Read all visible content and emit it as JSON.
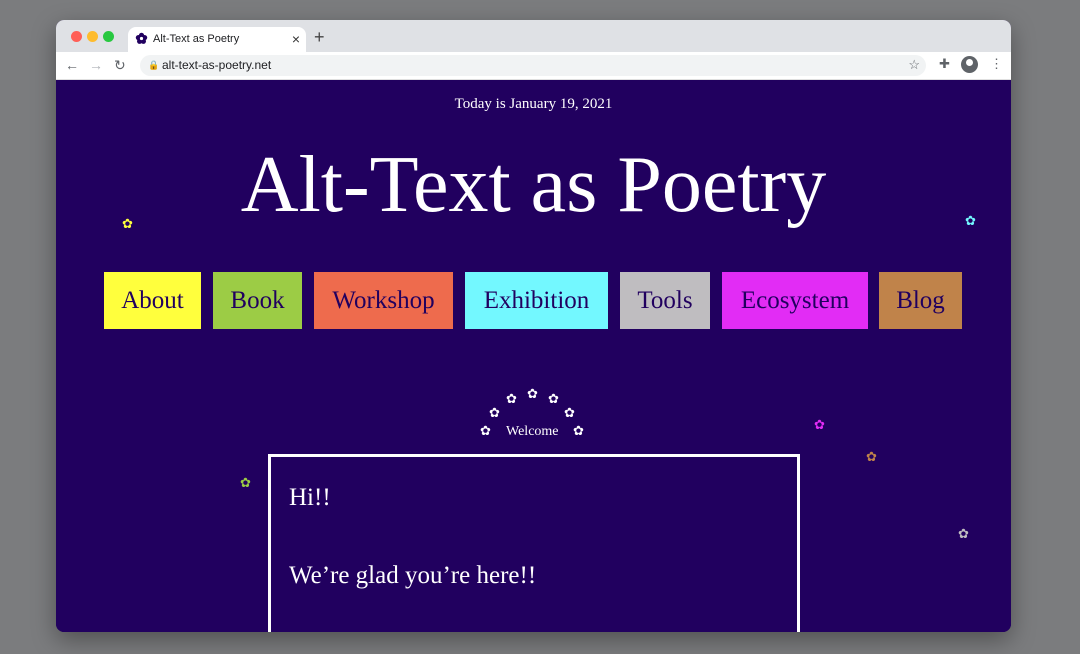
{
  "browser": {
    "tab_title": "Alt-Text as Poetry",
    "url": "alt-text-as-poetry.net",
    "icons": {
      "close": "×",
      "new_tab": "+",
      "back": "←",
      "forward": "→",
      "reload": "↻",
      "lock": "🔒",
      "star": "☆",
      "extensions": "✚",
      "menu": "⋮"
    }
  },
  "page": {
    "date_line": "Today is January 19, 2021",
    "title": "Alt-Text as Poetry",
    "nav": [
      {
        "label": "About",
        "color": "#ffff3d"
      },
      {
        "label": "Book",
        "color": "#9ccc45"
      },
      {
        "label": "Workshop",
        "color": "#ee6b4d"
      },
      {
        "label": "Exhibition",
        "color": "#73f8ff"
      },
      {
        "label": "Tools",
        "color": "#bfbdc0"
      },
      {
        "label": "Ecosystem",
        "color": "#e22cf5"
      },
      {
        "label": "Blog",
        "color": "#c0834a"
      }
    ],
    "welcome_label": "Welcome",
    "greeting": "Hi!!",
    "message": "We’re glad you’re here!!",
    "flower_glyph": "✿"
  },
  "colors": {
    "background": "#21005f",
    "text": "#ffffff"
  }
}
